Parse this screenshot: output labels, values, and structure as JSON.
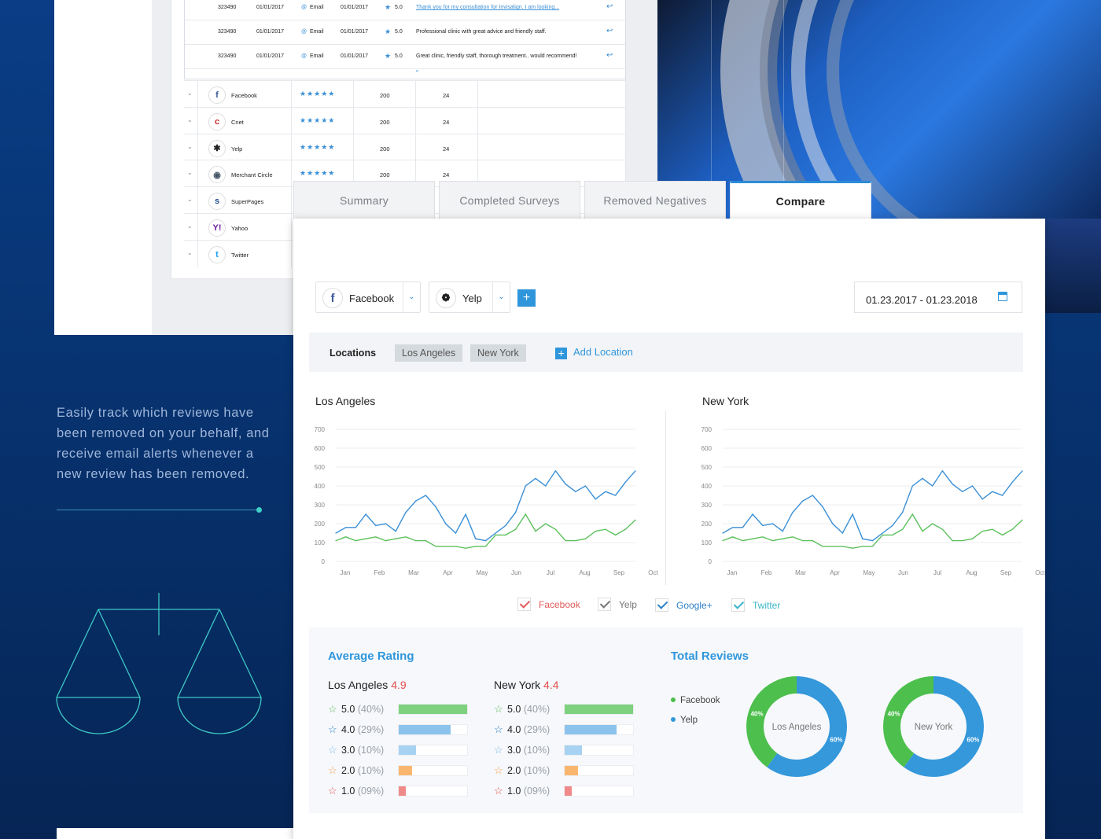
{
  "review_table": {
    "review_rows": [
      {
        "id": "323490",
        "date1": "01/01/2017",
        "channel": "Email",
        "date2": "01/01/2017",
        "rating": "5.0",
        "text": "Thank you for my consultation for Invisalign. I am looking...",
        "link": true
      },
      {
        "id": "323490",
        "date1": "01/01/2017",
        "channel": "Email",
        "date2": "01/01/2017",
        "rating": "5.0",
        "text": "Professional clinic with great advice and friendly staff.",
        "link": false
      },
      {
        "id": "323490",
        "date1": "01/01/2017",
        "channel": "Email",
        "date2": "01/01/2017",
        "rating": "5.0",
        "text": "Great clinic, friendly staff, thorough treatment.. would recommend!",
        "link": false
      }
    ],
    "sites": [
      {
        "name": "Facebook",
        "icon": "facebook-icon",
        "glyph": "f",
        "color": "#3b5998",
        "stars": "★★★★★",
        "reviews": "200",
        "count": "24"
      },
      {
        "name": "Cnet",
        "icon": "cnet-icon",
        "glyph": "c",
        "color": "#c62828",
        "stars": "★★★★★",
        "reviews": "200",
        "count": "24"
      },
      {
        "name": "Yelp",
        "icon": "yelp-icon",
        "glyph": "✱",
        "color": "#222",
        "stars": "★★★★★",
        "reviews": "200",
        "count": "24"
      },
      {
        "name": "Merchant Circle",
        "icon": "merchant-circle-icon",
        "glyph": "◉",
        "color": "#456",
        "stars": "★★★★★",
        "reviews": "200",
        "count": "24"
      },
      {
        "name": "SuperPages",
        "icon": "superpages-icon",
        "glyph": "s",
        "color": "#1e4f91",
        "stars": "",
        "reviews": "",
        "count": ""
      },
      {
        "name": "Yahoo",
        "icon": "yahoo-icon",
        "glyph": "Y!",
        "color": "#6b1fa0",
        "stars": "",
        "reviews": "",
        "count": ""
      },
      {
        "name": "Twitter",
        "icon": "twitter-icon",
        "glyph": "t",
        "color": "#1da1f2",
        "stars": "",
        "reviews": "",
        "count": ""
      }
    ]
  },
  "side": {
    "text": "Easily track which reviews have been removed on your behalf, and receive email alerts whenever a new review has been removed."
  },
  "tabs": [
    "Summary",
    "Completed Surveys",
    "Removed Negatives",
    "Compare"
  ],
  "active_tab": 3,
  "filters": {
    "source1": "Facebook",
    "source2": "Yelp",
    "add": "+",
    "date_range": "01.23.2017 - 01.23.2018"
  },
  "locations": {
    "label": "Locations",
    "chips": [
      "Los Angeles",
      "New York"
    ],
    "add_label": "Add Location"
  },
  "colors": {
    "accent": "#2f96db",
    "blue_line": "#3a8fd6",
    "green_line": "#5cc05c",
    "red": "#e44d4d"
  },
  "chart_data": [
    {
      "type": "line",
      "title": "Los Angeles",
      "categories": [
        "Jan",
        "Feb",
        "Mar",
        "Apr",
        "May",
        "Jun",
        "Jul",
        "Aug",
        "Sep",
        "Oct"
      ],
      "y_ticks": [
        "700",
        "600",
        "500",
        "400",
        "300",
        "200",
        "100",
        "0"
      ],
      "ylim": [
        0,
        700
      ],
      "series": [
        {
          "values": [
            150,
            180,
            180,
            250,
            190,
            200,
            160,
            260,
            320,
            350,
            290,
            200,
            150,
            250,
            120,
            110,
            150,
            190,
            260,
            400,
            440,
            400,
            480,
            410,
            370,
            400,
            330,
            370,
            350,
            420,
            480
          ]
        },
        {
          "values": [
            110,
            130,
            110,
            120,
            130,
            110,
            120,
            130,
            110,
            110,
            80,
            80,
            80,
            70,
            80,
            80,
            140,
            140,
            170,
            250,
            160,
            200,
            170,
            110,
            110,
            120,
            160,
            170,
            140,
            170,
            220
          ]
        }
      ]
    },
    {
      "type": "line",
      "title": "New York",
      "categories": [
        "Jan",
        "Feb",
        "Mar",
        "Apr",
        "May",
        "Jun",
        "Jul",
        "Aug",
        "Sep",
        "Oct"
      ],
      "y_ticks": [
        "700",
        "600",
        "500",
        "400",
        "300",
        "200",
        "100",
        "0"
      ],
      "ylim": [
        0,
        700
      ],
      "series": [
        {
          "values": [
            150,
            180,
            180,
            250,
            190,
            200,
            160,
            260,
            320,
            350,
            290,
            200,
            150,
            250,
            120,
            110,
            150,
            190,
            260,
            400,
            440,
            400,
            480,
            410,
            370,
            400,
            330,
            370,
            350,
            420,
            480
          ]
        },
        {
          "values": [
            110,
            130,
            110,
            120,
            130,
            110,
            120,
            130,
            110,
            110,
            80,
            80,
            80,
            70,
            80,
            80,
            140,
            140,
            170,
            250,
            160,
            200,
            170,
            110,
            110,
            120,
            160,
            170,
            140,
            170,
            220
          ]
        }
      ]
    },
    {
      "type": "pie",
      "center_label": "Los Angeles",
      "slices": [
        {
          "label": "Facebook",
          "value": 40,
          "text": "40%"
        },
        {
          "label": "Yelp",
          "value": 60,
          "text": "60%"
        }
      ]
    },
    {
      "type": "pie",
      "center_label": "New York",
      "slices": [
        {
          "label": "Facebook",
          "value": 40,
          "text": "40%"
        },
        {
          "label": "Yelp",
          "value": 60,
          "text": "60%"
        }
      ]
    }
  ],
  "legend": [
    {
      "label": "Facebook",
      "color": "#e25b5b"
    },
    {
      "label": "Yelp",
      "color": "#777"
    },
    {
      "label": "Google+",
      "color": "#2f80c8"
    },
    {
      "label": "Twitter",
      "color": "#3bb6c8"
    }
  ],
  "avg_rating": {
    "title": "Average Rating",
    "locations": [
      {
        "name": "Los Angeles",
        "score": "4.9",
        "rows": [
          {
            "rating": "5.0",
            "pct": "(40%)",
            "fill": 1.0,
            "color": "#7ed17e",
            "star": "#5cc05c"
          },
          {
            "rating": "4.0",
            "pct": "(29%)",
            "fill": 0.76,
            "color": "#8cc3ec",
            "star": "#2f80c8"
          },
          {
            "rating": "3.0",
            "pct": "(10%)",
            "fill": 0.25,
            "color": "#a8d2f2",
            "star": "#7ab8e6"
          },
          {
            "rating": "2.0",
            "pct": "(10%)",
            "fill": 0.19,
            "color": "#f9b66f",
            "star": "#f59f4a"
          },
          {
            "rating": "1.0",
            "pct": "(09%)",
            "fill": 0.1,
            "color": "#f08a8a",
            "star": "#e44d4d"
          }
        ]
      },
      {
        "name": "New York",
        "score": "4.4",
        "rows": [
          {
            "rating": "5.0",
            "pct": "(40%)",
            "fill": 1.0,
            "color": "#7ed17e",
            "star": "#5cc05c"
          },
          {
            "rating": "4.0",
            "pct": "(29%)",
            "fill": 0.76,
            "color": "#8cc3ec",
            "star": "#2f80c8"
          },
          {
            "rating": "3.0",
            "pct": "(10%)",
            "fill": 0.25,
            "color": "#a8d2f2",
            "star": "#7ab8e6"
          },
          {
            "rating": "2.0",
            "pct": "(10%)",
            "fill": 0.19,
            "color": "#f9b66f",
            "star": "#f59f4a"
          },
          {
            "rating": "1.0",
            "pct": "(09%)",
            "fill": 0.1,
            "color": "#f08a8a",
            "star": "#e44d4d"
          }
        ]
      }
    ]
  },
  "total_reviews": {
    "title": "Total Reviews",
    "legend": [
      {
        "label": "Facebook",
        "color": "#4cbf4c"
      },
      {
        "label": "Yelp",
        "color": "#3498db"
      }
    ]
  }
}
